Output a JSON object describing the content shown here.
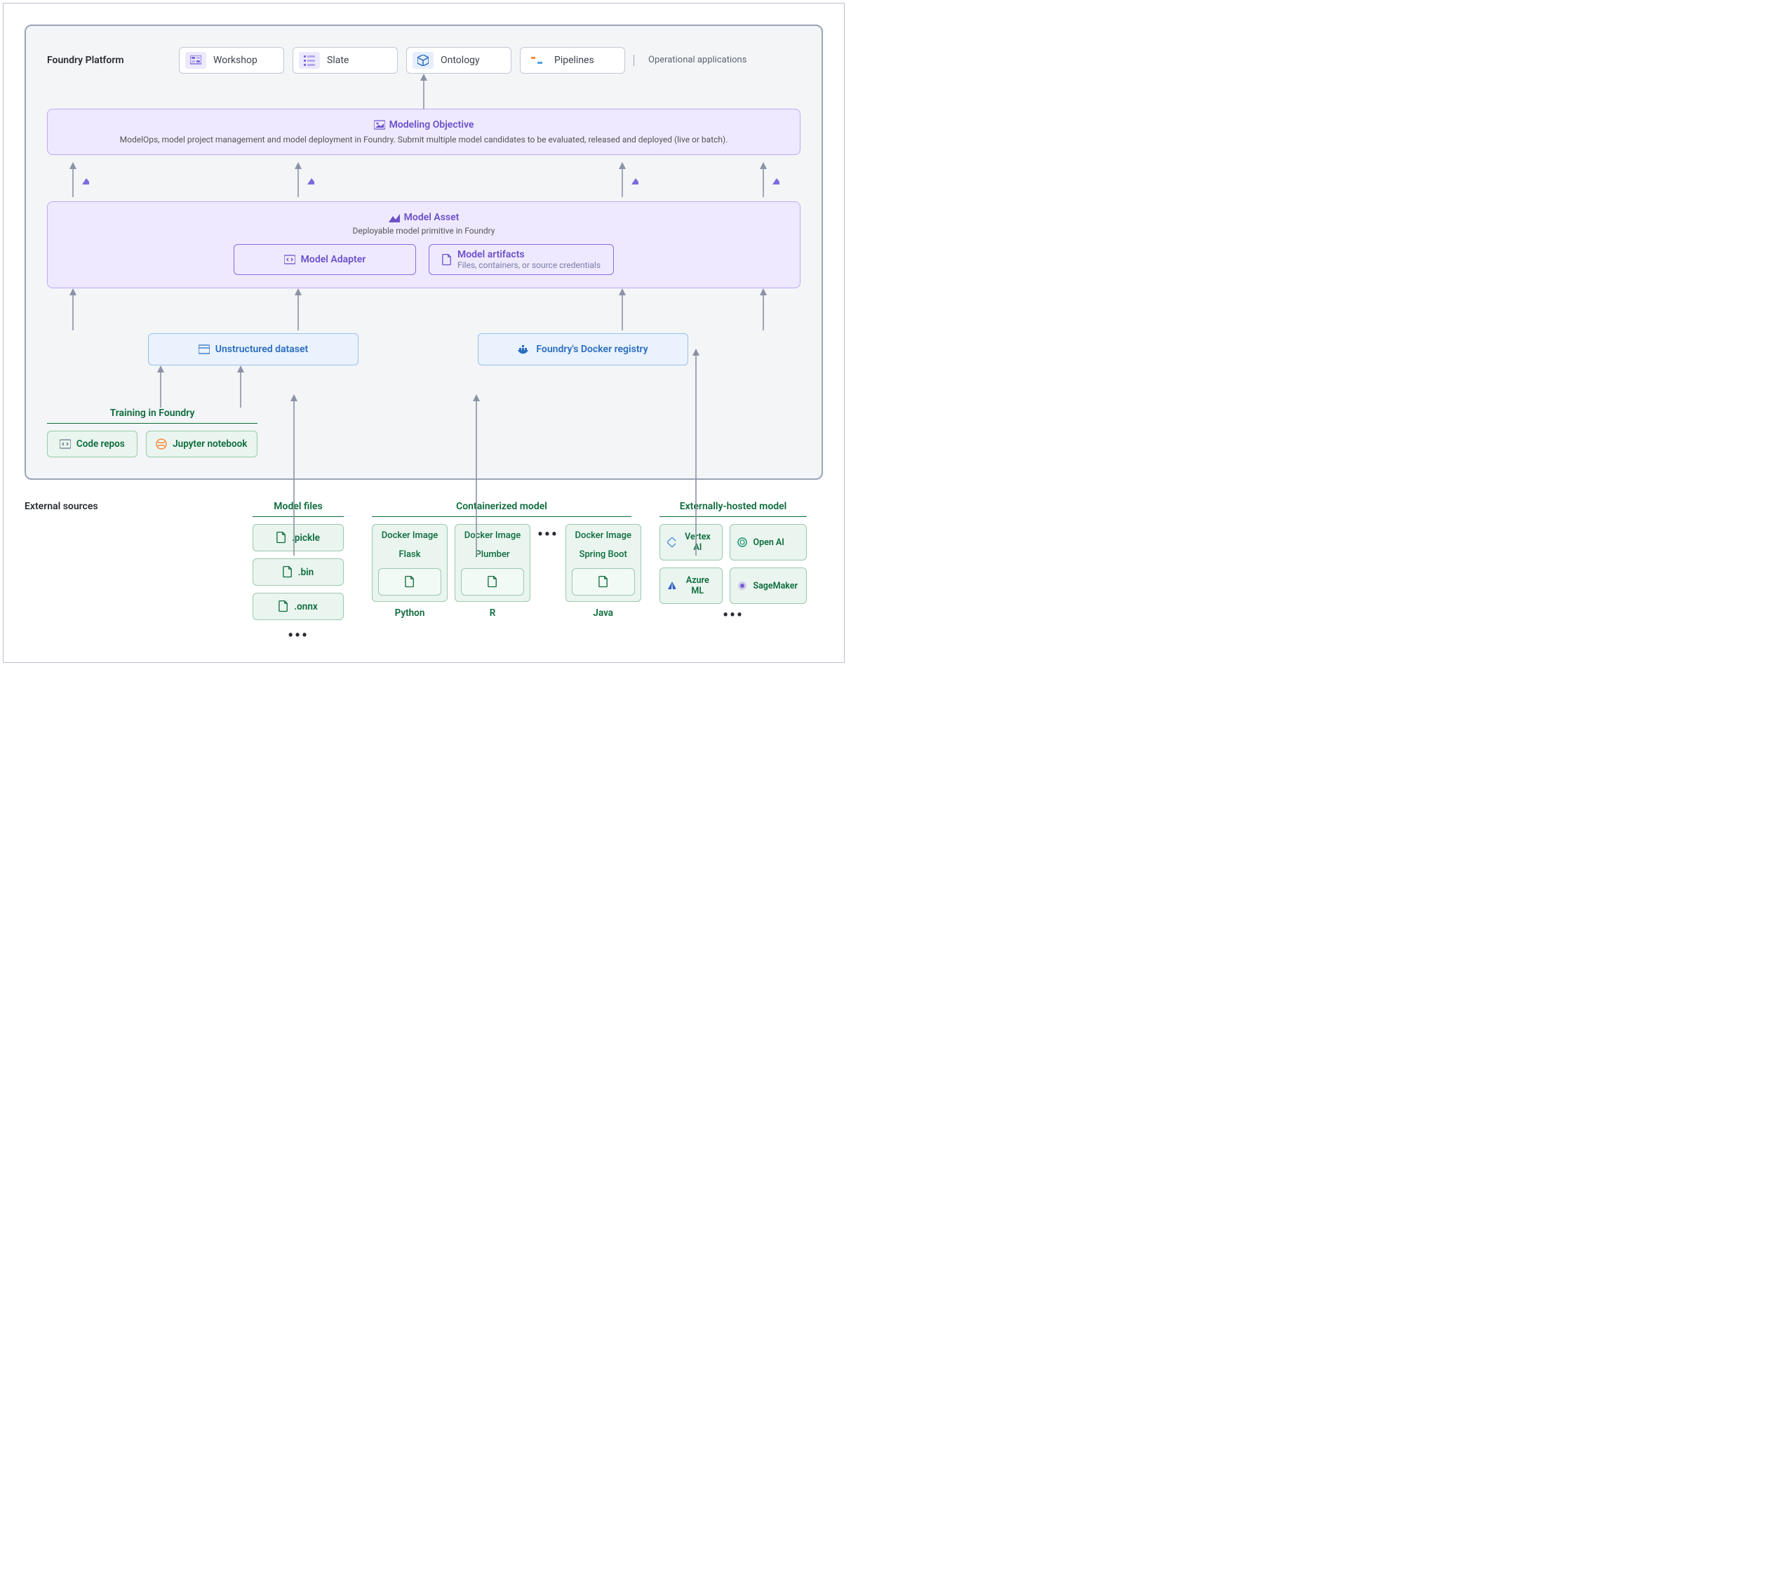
{
  "platform": {
    "label": "Foundry Platform",
    "tiles": [
      {
        "name": "workshop",
        "label": "Workshop"
      },
      {
        "name": "slate",
        "label": "Slate"
      },
      {
        "name": "ontology",
        "label": "Ontology"
      },
      {
        "name": "pipelines",
        "label": "Pipelines"
      }
    ],
    "op_apps": "Operational applications"
  },
  "modeling_objective": {
    "title": "Modeling Objective",
    "sub": "ModelOps, model project management and model deployment in Foundry. Submit multiple model candidates to be evaluated, released and deployed (live or batch)."
  },
  "model_asset": {
    "title": "Model Asset",
    "sub": "Deployable model primitive in Foundry",
    "adapter": "Model Adapter",
    "artifacts": {
      "title": "Model artifacts",
      "sub": "Files, containers, or source credentials"
    }
  },
  "unstructured": "Unstructured dataset",
  "docker_registry": "Foundry's Docker registry",
  "training": {
    "title": "Training in Foundry",
    "items": [
      "Code repos",
      "Jupyter notebook"
    ]
  },
  "external": {
    "label": "External sources",
    "model_files": {
      "title": "Model files",
      "items": [
        ".pickle",
        ".bin",
        ".onnx"
      ]
    },
    "containerized": {
      "title": "Containerized model",
      "docker_label": "Docker Image",
      "frameworks": [
        "Flask",
        "Plumber",
        "Spring Boot"
      ],
      "langs": [
        "Python",
        "R",
        "Java"
      ]
    },
    "hosted": {
      "title": "Externally-hosted model",
      "items": [
        "Vertex AI",
        "Open AI",
        "Azure ML",
        "SageMaker"
      ]
    }
  },
  "ellipsis": "•••"
}
